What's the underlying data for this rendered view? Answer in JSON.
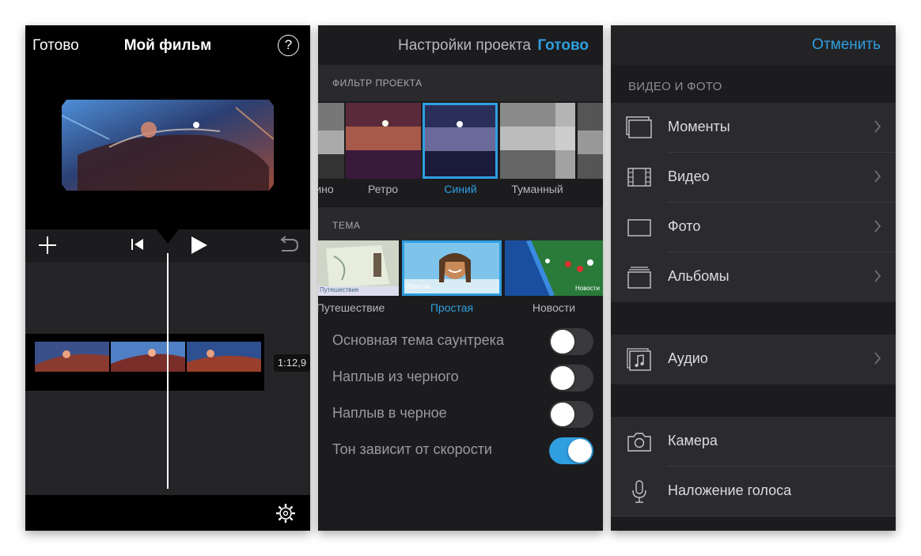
{
  "editor": {
    "done_label": "Готово",
    "title": "Мой фильм",
    "help_label": "?",
    "clip_duration": "1:12,9"
  },
  "settings": {
    "title": "Настройки проекта",
    "done_label": "Готово",
    "filter_section": "ФИЛЬТР ПРОЕКТА",
    "filters": [
      {
        "label": "ино",
        "selected": false
      },
      {
        "label": "Ретро",
        "selected": false
      },
      {
        "label": "Синий",
        "selected": true
      },
      {
        "label": "Туманный",
        "selected": false
      }
    ],
    "theme_section": "ТЕМА",
    "themes": [
      {
        "label": "Путешествие",
        "badge": "Путешествие",
        "selected": false
      },
      {
        "label": "Простая",
        "badge": "Простая",
        "selected": true
      },
      {
        "label": "Новости",
        "badge": "Новости",
        "selected": false
      }
    ],
    "options": [
      {
        "label": "Основная тема саунтрека",
        "on": false
      },
      {
        "label": "Наплыв из черного",
        "on": false
      },
      {
        "label": "Наплыв в черное",
        "on": false
      },
      {
        "label": "Тон зависит от скорости",
        "on": true
      }
    ]
  },
  "media": {
    "cancel_label": "Отменить",
    "section_label": "ВИДЕО И ФОТО",
    "items": [
      {
        "label": "Моменты",
        "icon": "moments-icon"
      },
      {
        "label": "Видео",
        "icon": "film-icon"
      },
      {
        "label": "Фото",
        "icon": "photo-icon"
      },
      {
        "label": "Альбомы",
        "icon": "albums-icon"
      }
    ],
    "audio_label": "Аудио",
    "camera_label": "Камера",
    "voiceover_label": "Наложение голоса"
  },
  "colors": {
    "accent": "#2f9fe0",
    "panel_bg": "#1c1c1e",
    "list_bg": "#2b2b2d"
  }
}
